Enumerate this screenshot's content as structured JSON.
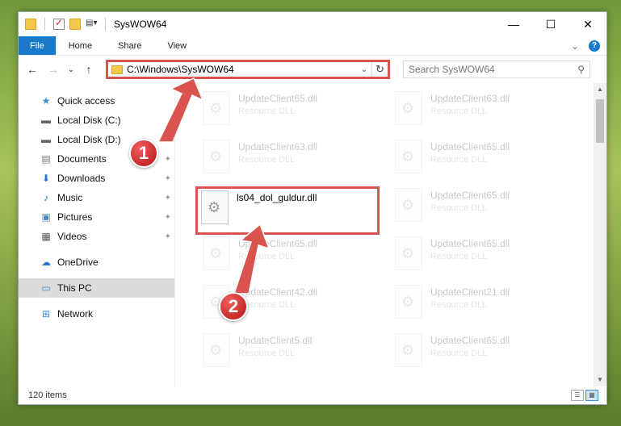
{
  "window": {
    "title": "SysWOW64",
    "controls": {
      "minimize": "—",
      "maximize": "☐",
      "close": "✕"
    }
  },
  "ribbon": {
    "tabs": [
      "File",
      "Home",
      "Share",
      "View"
    ],
    "expand_glyph": "⌄",
    "help_glyph": "?"
  },
  "navbar": {
    "back": "←",
    "forward": "→",
    "recent": "⌄",
    "up": "↑",
    "address": "C:\\Windows\\SysWOW64",
    "address_dropdown": "⌄",
    "refresh": "↻",
    "search_placeholder": "Search SysWOW64"
  },
  "sidebar": {
    "items": [
      {
        "label": "Quick access",
        "icon": "★"
      },
      {
        "label": "Local Disk (C:)",
        "icon": "▬",
        "pinned": true
      },
      {
        "label": "Local Disk (D:)",
        "icon": "▬",
        "pinned": true
      },
      {
        "label": "Documents",
        "icon": "▤",
        "pinned": true
      },
      {
        "label": "Downloads",
        "icon": "⬇",
        "pinned": true
      },
      {
        "label": "Music",
        "icon": "♪",
        "pinned": true
      },
      {
        "label": "Pictures",
        "icon": "▣",
        "pinned": true
      },
      {
        "label": "Videos",
        "icon": "▦",
        "pinned": true
      },
      {
        "label": "OneDrive",
        "icon": "☁"
      },
      {
        "label": "This PC",
        "icon": "▭"
      },
      {
        "label": "Network",
        "icon": "⊞"
      }
    ],
    "pin_glyph": "✦"
  },
  "files": {
    "highlighted": {
      "name": "ls04_dol_guldur.dll"
    },
    "faded": [
      {
        "name": "UpdateClient65.dll",
        "type": "Resource DLL"
      },
      {
        "name": "UpdateClient63.dll",
        "type": "Resource DLL"
      },
      {
        "name": "UpdateClient63.dll",
        "type": "Resource DLL"
      },
      {
        "name": "UpdateClient65.dll",
        "type": "Resource DLL"
      },
      {
        "name": "UpdateClient65.dll",
        "type": "Resource DLL"
      },
      {
        "name": "UpdateClient65.dll",
        "type": "Resource DLL"
      },
      {
        "name": "UpdateClient65.dll",
        "type": "Resource DLL"
      },
      {
        "name": "UpdateClient42.dll",
        "type": "Resource DLL"
      },
      {
        "name": "UpdateClient21.dll",
        "type": "Resource DLL"
      },
      {
        "name": "UpdateClient5.dll",
        "type": "Resource DLL"
      },
      {
        "name": "UpdateClient65.dll",
        "type": "Resource DLL"
      }
    ]
  },
  "status": {
    "count": "120 items"
  },
  "annotations": {
    "step1": "1",
    "step2": "2",
    "accent": "#d9534f"
  },
  "scroll": {
    "up": "▲",
    "down": "▼"
  }
}
